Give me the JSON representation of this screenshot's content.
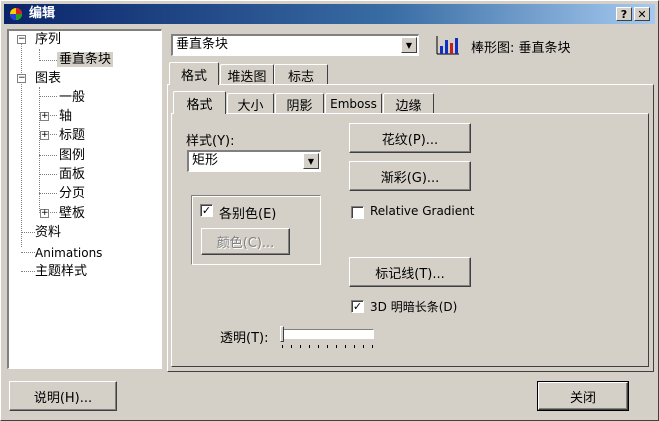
{
  "window": {
    "title": "编辑",
    "help_glyph": "?",
    "close_glyph": "✕"
  },
  "tree": {
    "items": [
      {
        "label": "序列",
        "expander": "−"
      },
      {
        "label": "垂直条块",
        "selected": true
      },
      {
        "label": "图表",
        "expander": "−"
      },
      {
        "label": "一般"
      },
      {
        "label": "轴",
        "expander": "+"
      },
      {
        "label": "标题",
        "expander": "+"
      },
      {
        "label": "图例"
      },
      {
        "label": "面板"
      },
      {
        "label": "分页"
      },
      {
        "label": "壁板",
        "expander": "+"
      },
      {
        "label": "资料"
      },
      {
        "label": "Animations"
      },
      {
        "label": "主题样式"
      }
    ]
  },
  "series_select": {
    "value": "垂直条块",
    "arrow": "▼"
  },
  "series_type": {
    "icon": "bar-chart-icon",
    "label": "棒形图: 垂直条块"
  },
  "outer_tabs": [
    "格式",
    "堆迭图",
    "标志"
  ],
  "inner_tabs": [
    "格式",
    "大小",
    "阴影",
    "Emboss",
    "边缘"
  ],
  "format": {
    "style_label": "样式(Y):",
    "style_value": "矩形",
    "style_arrow": "▼",
    "each_color_label": "各别色(E)",
    "each_color_checked": "✓",
    "color_button": "颜色(C)...",
    "pattern_button": "花纹(P)...",
    "gradient_button": "渐彩(G)...",
    "relative_gradient_label": "Relative Gradient",
    "marks_button": "标记线(T)...",
    "dark_3d_label": "3D 明暗长条(D)",
    "dark_3d_checked": "✓",
    "transparency_label": "透明(T):",
    "transparency_value": 0
  },
  "footer": {
    "help_button": "说明(H)...",
    "close_button": "关闭"
  },
  "colors": {
    "title_start": "#0a246a",
    "title_end": "#a6caf0",
    "face": "#d4d0c8"
  }
}
